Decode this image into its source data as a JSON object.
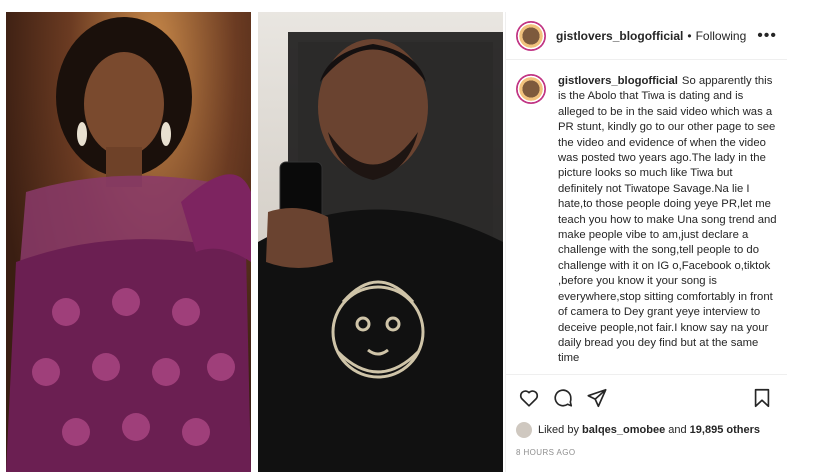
{
  "post": {
    "username": "gistlovers_blogofficial",
    "separator": "•",
    "follow_status": "Following",
    "more": "•••"
  },
  "caption": {
    "username": "gistlovers_blogofficial",
    "text": "So apparently this is the Abolo that Tiwa is dating and is alleged to be in the said video which was a PR stunt, kindly go to our other page to see the video and evidence of when the video was posted two years ago.The lady in the picture looks so much like Tiwa but definitely not Tiwatope Savage.Na lie I hate,to those people doing yeye PR,let me teach you how to make Una song trend and make people vibe to am,just declare a challenge with the song,tell people to do challenge with it on IG o,Facebook o,tiktok ,before you know it your song is everywhere,stop sitting comfortably in front of camera to Dey grant yeye interview to deceive people,not fair.I know say na your daily bread you dey find but at the same time"
  },
  "actions": {
    "like": "heart-icon",
    "comment": "comment-icon",
    "share": "share-icon",
    "save": "bookmark-icon"
  },
  "likes": {
    "prefix": "Liked by",
    "user": "balqes_omobee",
    "and": "and",
    "count": "19,895 others"
  },
  "timestamp": "8 HOURS AGO",
  "colors": {
    "text": "#262626",
    "muted": "#8e8e8e",
    "border": "#efefef"
  }
}
